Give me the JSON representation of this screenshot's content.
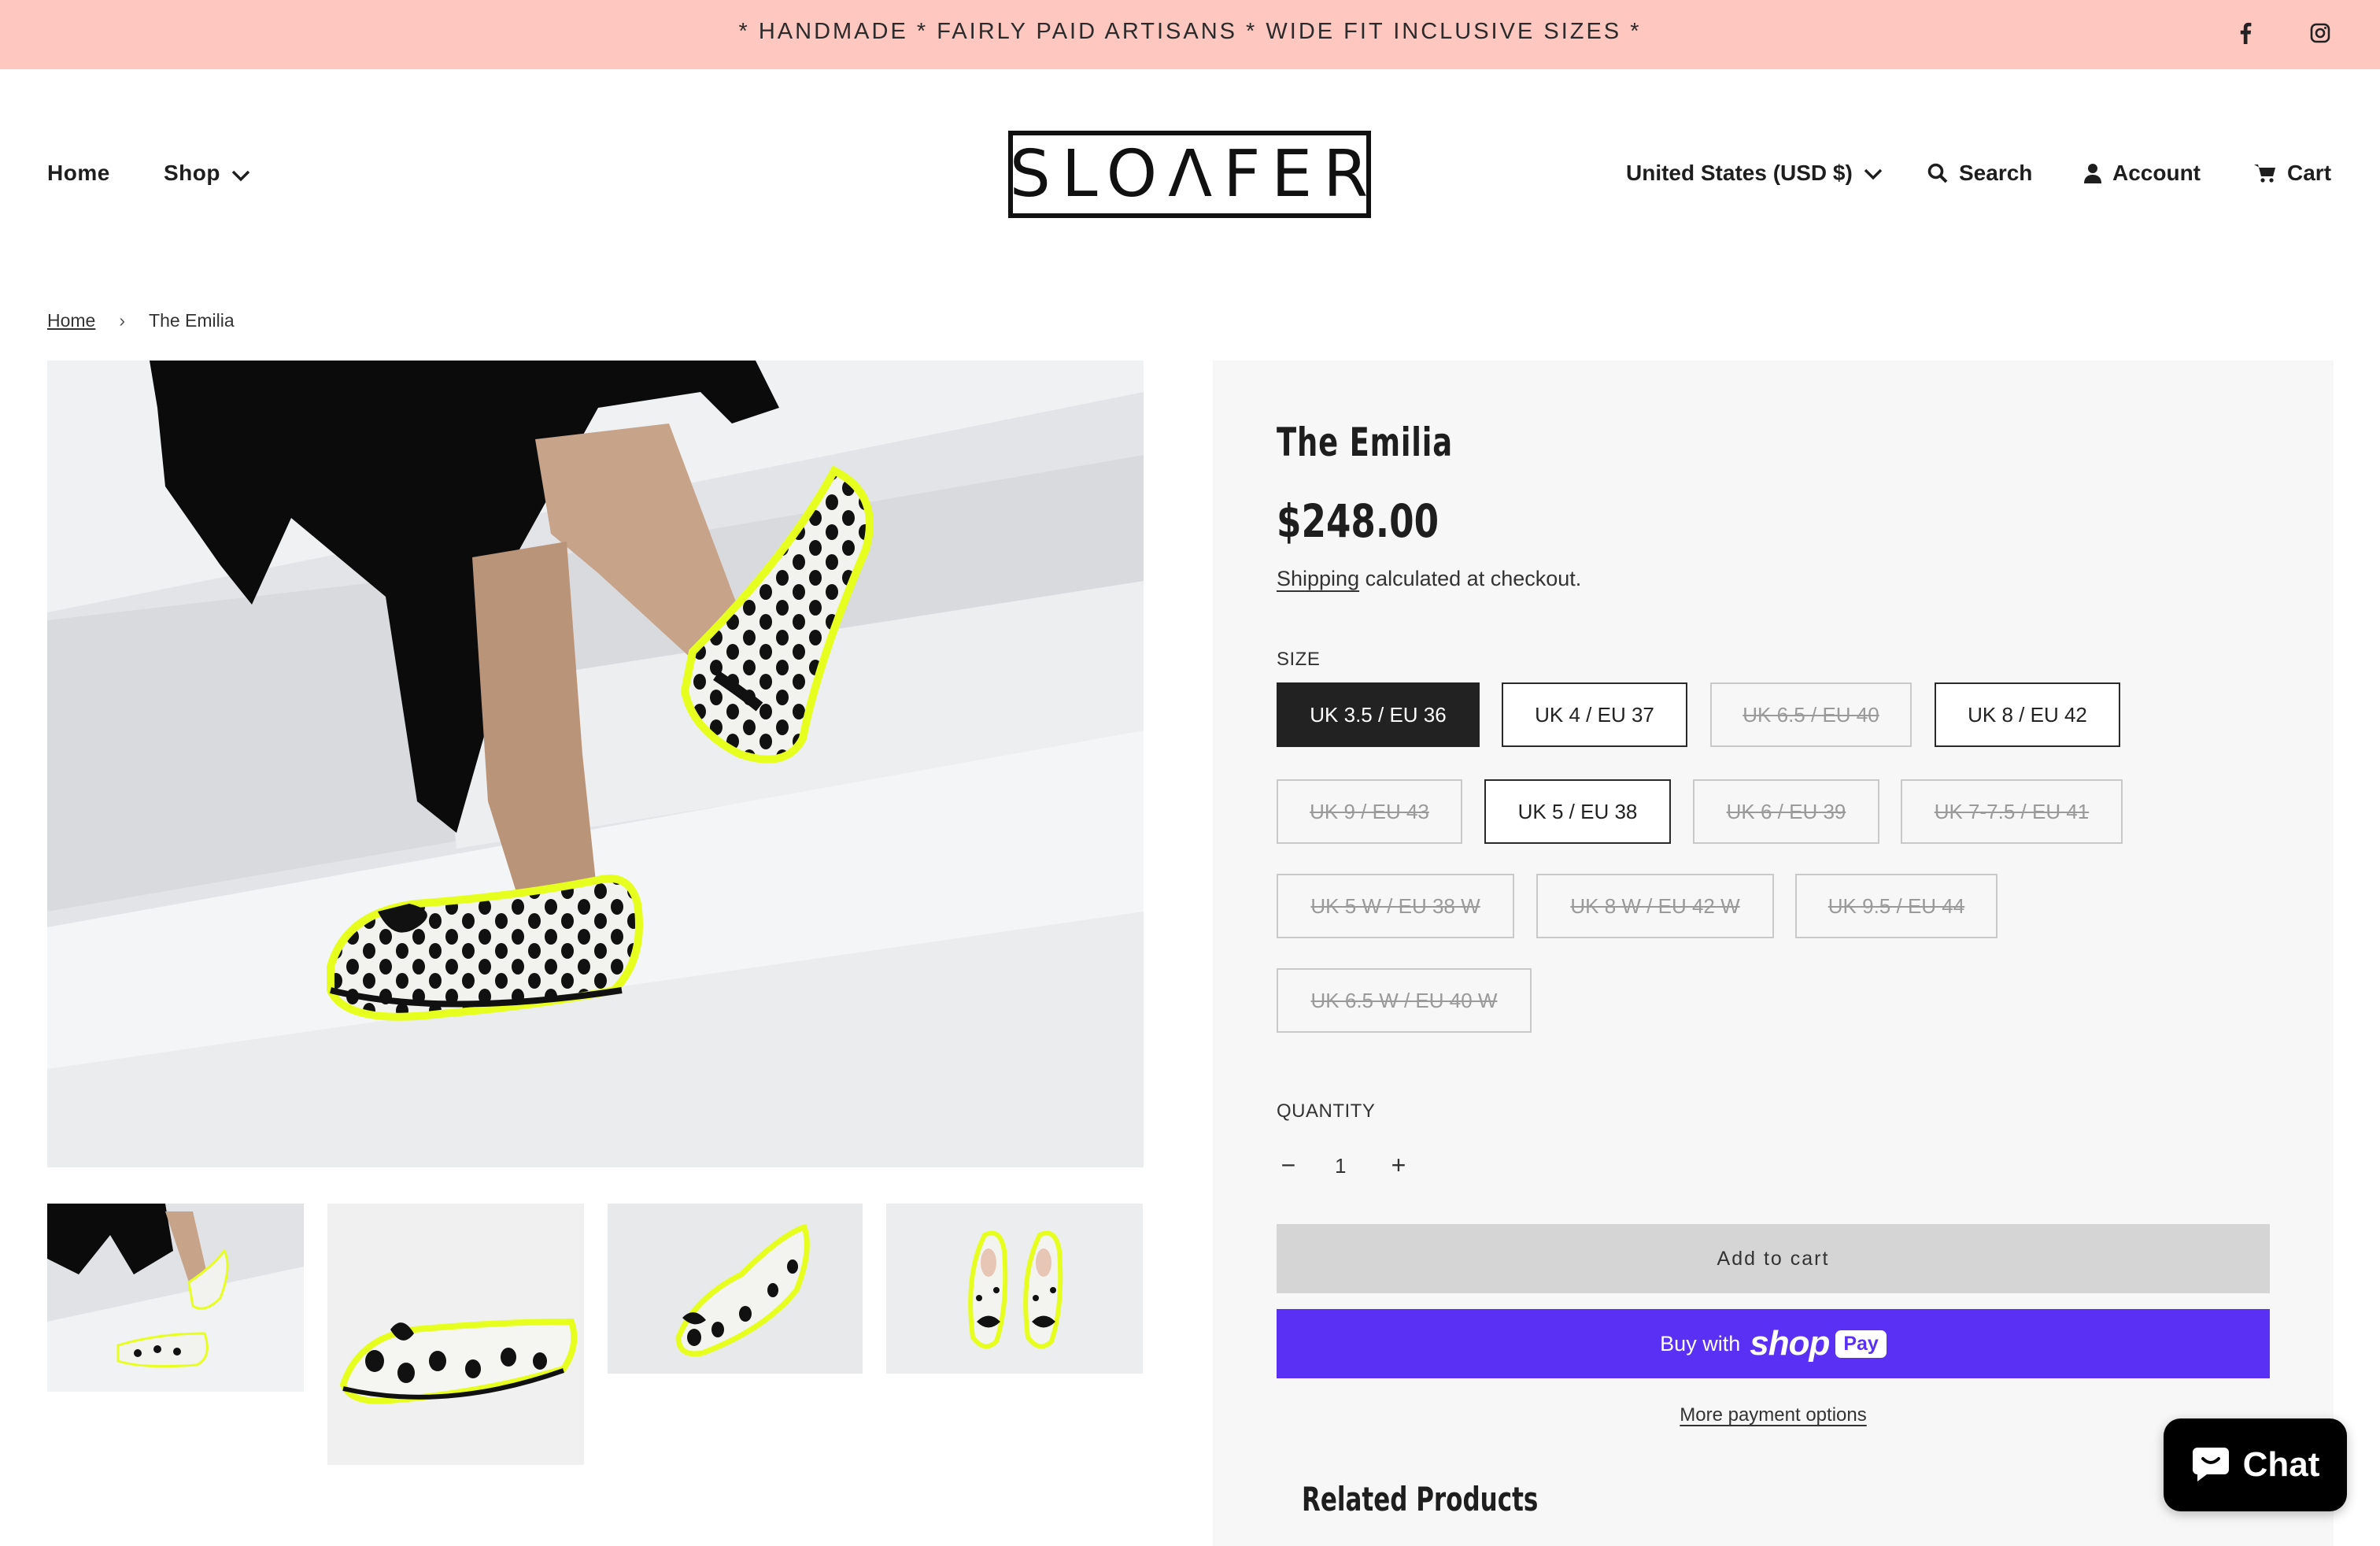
{
  "announcement": {
    "text": "* HANDMADE * FAIRLY PAID ARTISANS * WIDE FIT INCLUSIVE SIZES *"
  },
  "social": [
    {
      "icon": "facebook-icon"
    },
    {
      "icon": "instagram-icon"
    }
  ],
  "nav": {
    "home": "Home",
    "shop": "Shop"
  },
  "logo": {
    "text": "SLOΛFER"
  },
  "header": {
    "currency": "United States (USD $)",
    "search": "Search",
    "account": "Account",
    "cart": "Cart"
  },
  "breadcrumb": {
    "home": "Home",
    "separator": "›",
    "current": "The Emilia"
  },
  "product": {
    "title": "The Emilia",
    "price": "$248.00",
    "shipping_link": "Shipping",
    "shipping_text": " calculated at checkout.",
    "size_label": "SIZE",
    "sizes": [
      {
        "label": "UK 3.5 / EU 36",
        "state": "selected"
      },
      {
        "label": "UK 4 / EU 37",
        "state": "available"
      },
      {
        "label": "UK 6.5 / EU 40",
        "state": "sold-out"
      },
      {
        "label": "UK 8 / EU 42",
        "state": "available"
      },
      {
        "label": "UK 9 / EU 43",
        "state": "sold-out"
      },
      {
        "label": "UK 5 / EU 38",
        "state": "available"
      },
      {
        "label": "UK 6 / EU 39",
        "state": "sold-out"
      },
      {
        "label": "UK 7-7.5 / EU 41",
        "state": "sold-out"
      },
      {
        "label": "UK 5 W / EU 38 W",
        "state": "sold-out"
      },
      {
        "label": "UK 8 W / EU 42 W",
        "state": "sold-out"
      },
      {
        "label": "UK 9.5 / EU 44",
        "state": "sold-out"
      },
      {
        "label": "UK 6.5 W / EU 40 W",
        "state": "sold-out"
      }
    ],
    "quantity_label": "QUANTITY",
    "quantity_minus": "−",
    "quantity_value": "1",
    "quantity_plus": "+",
    "add_to_cart": "Add to cart",
    "buy_with": "Buy with",
    "shop_word": "shop",
    "pay_word": "Pay",
    "more_payment": "More payment options",
    "related_heading": "Related Products"
  },
  "chat": {
    "label": "Chat",
    "icon": "chat-bubble-icon"
  },
  "colors": {
    "announcement_bg": "#fec8c1",
    "shop_pay": "#5a31f4",
    "panel_bg": "#f7f7f7",
    "shoe_trim": "#e6ff1f"
  }
}
